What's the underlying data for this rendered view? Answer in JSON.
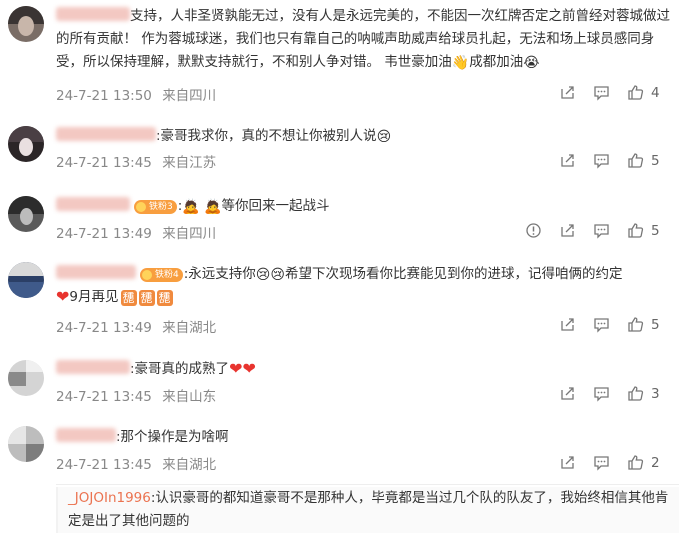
{
  "comments": [
    {
      "name": "",
      "text_pre": "支持，人非圣贤孰能无过，没有人是永远完美的，不能因一次红牌否定之前曾经对蓉城做过的所有贡献！ 作为蓉城球迷，我们也只有靠自己的呐喊声助威声给球员扎起，无法和场上球员感同身受，所以保持理解，默默支持就行，不和别人争对错。 韦世豪加油",
      "text_mid": "成都加油",
      "time": "24-7-21 13:50",
      "location": "来自四川",
      "likes": "4",
      "avatar": [
        "#3a3433",
        "#c8b6aa",
        "#7a6d66"
      ]
    },
    {
      "name": "",
      "text": ":豪哥我求你，真的不想让你被别人说",
      "time": "24-7-21 13:45",
      "location": "来自江苏",
      "likes": "5",
      "avatar": [
        "#4a3f44",
        "#e9dfe0",
        "#2b2527"
      ]
    },
    {
      "name": "",
      "fan_badge": "铁粉3",
      "text": "等你回来一起战斗",
      "time": "24-7-21 13:49",
      "location": "来自四川",
      "likes": "5",
      "avatar": [
        "#2c2c2c",
        "#bcbcbc",
        "#5a5a5a"
      ]
    },
    {
      "name": "",
      "fan_badge": "铁粉4",
      "text_a": ":永远支持你",
      "text_b": "希望下次现场看你比赛能见到你的进球，记得咱俩的约定",
      "text_c": "9月再见",
      "time": "24-7-21 13:49",
      "location": "来自湖北",
      "likes": "5",
      "avatar": [
        "#3f5a8a",
        "#d9d9d9",
        "#2b3f66"
      ]
    },
    {
      "name": "",
      "text": ":豪哥真的成熟了",
      "time": "24-7-21 13:45",
      "location": "来自山东",
      "likes": "3",
      "avatar": [
        "#d4d4d4",
        "#8a8a8a",
        "#f0f0f0"
      ]
    },
    {
      "name": "",
      "text": ":那个操作是为啥啊",
      "time": "24-7-21 13:45",
      "location": "来自湖北",
      "likes": "2",
      "avatar": [
        "#bdbdbd",
        "#e6e6e6",
        "#7d7d7d"
      ]
    }
  ],
  "reply": {
    "name": "_JOJOIn1996",
    "text": ":认识豪哥的都知道豪哥不是那种人，毕竟都是当过几个队的队友了，我始终相信其他肯定是出了其他问题的"
  },
  "icons": {
    "share": "share-icon",
    "comment": "comment-icon",
    "like": "like-icon",
    "report": "report-icon"
  }
}
